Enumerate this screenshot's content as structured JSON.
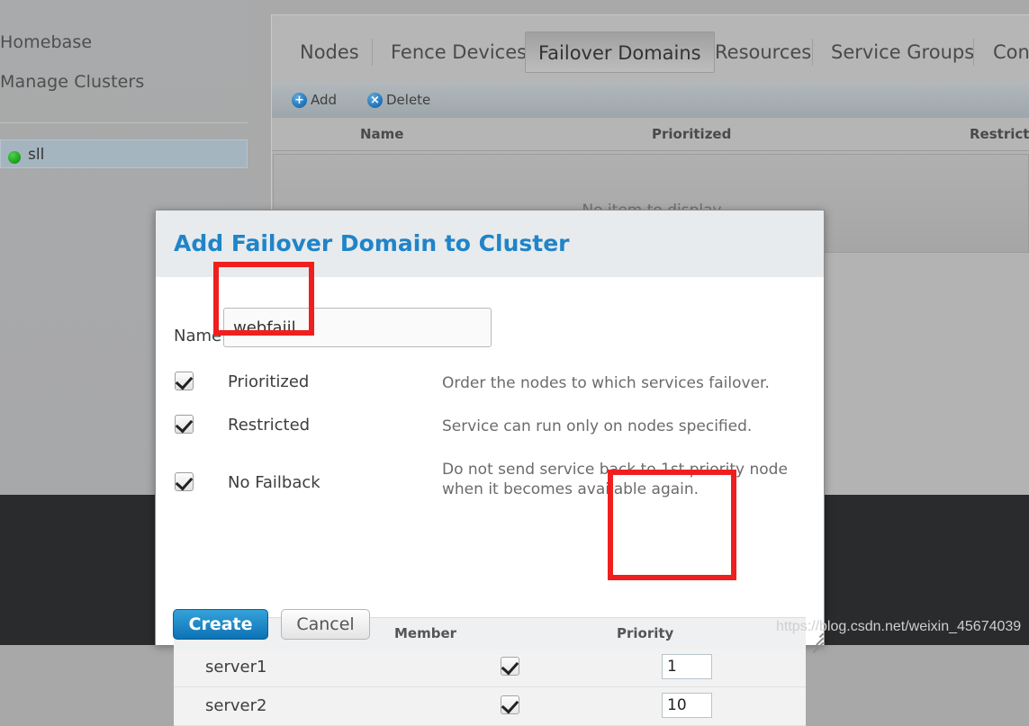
{
  "sidebar": {
    "links": [
      {
        "label": "Homebase"
      },
      {
        "label": "Manage Clusters"
      }
    ],
    "selected_cluster": {
      "label": "sll",
      "status_icon": "green-dot-icon"
    }
  },
  "main": {
    "tabs": [
      {
        "label": "Nodes",
        "active": false
      },
      {
        "label": "Fence Devices",
        "active": false
      },
      {
        "label": "Failover Domains",
        "active": true
      },
      {
        "label": "Resources",
        "active": false
      },
      {
        "label": "Service Groups",
        "active": false
      },
      {
        "label": "Conf",
        "active": false
      }
    ],
    "toolbar": {
      "add_label": "Add",
      "add_icon": "plus-circle-icon",
      "delete_label": "Delete",
      "delete_icon": "x-circle-icon"
    },
    "grid": {
      "columns": [
        "Name",
        "Prioritized",
        "Restricted"
      ],
      "empty_message": "No item to display"
    }
  },
  "dialog": {
    "title": "Add Failover Domain to Cluster",
    "name_label": "Name",
    "name_value": "webfaiil",
    "name_placeholder": "",
    "options": [
      {
        "label": "Prioritized",
        "checked": true,
        "description": "Order the nodes to which services failover."
      },
      {
        "label": "Restricted",
        "checked": true,
        "description": "Service can run only on nodes specified."
      },
      {
        "label": "No Failback",
        "checked": true,
        "description": "Do not send service back to 1st priority node when it becomes available again."
      }
    ],
    "member_table": {
      "columns": {
        "member": "Member",
        "priority": "Priority"
      },
      "rows": [
        {
          "name": "server1",
          "member_checked": true,
          "priority": "1"
        },
        {
          "name": "server2",
          "member_checked": true,
          "priority": "10"
        }
      ]
    },
    "create_label": "Create",
    "cancel_label": "Cancel",
    "resize_icon": "resize-grip-icon"
  },
  "annotations": {
    "accent_color": "#f01f1f",
    "boxes": [
      "name-field-highlight",
      "priority-column-highlight"
    ]
  },
  "watermark": "https://blog.csdn.net/weixin_45674039"
}
